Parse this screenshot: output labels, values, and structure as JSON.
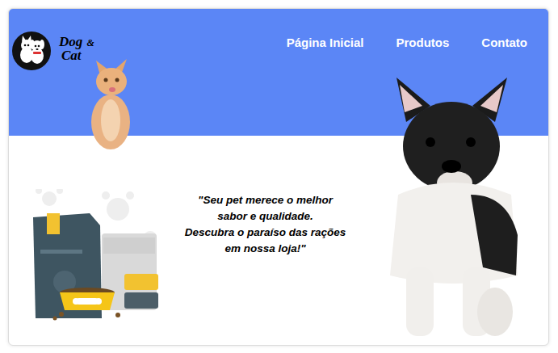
{
  "logo": {
    "line1": "Dog",
    "amp": "&",
    "line2": "Cat"
  },
  "nav": [
    {
      "label": "Página Inicial"
    },
    {
      "label": "Produtos"
    },
    {
      "label": "Contato"
    }
  ],
  "hero": {
    "quote_lines": [
      "\"Seu pet merece o melhor",
      "sabor e qualidade.",
      "Descubra o paraíso das rações",
      "em nossa loja!\""
    ]
  }
}
